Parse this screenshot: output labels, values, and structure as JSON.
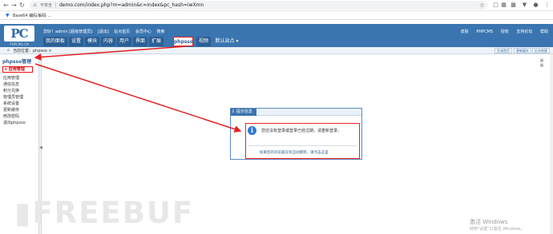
{
  "browser": {
    "insecure_label": "不安全",
    "url": "demo.com/index.php?m=admin&c=index&pc_hash=iwXmn",
    "bookmark_label": "Base64 编码/解码 ..."
  },
  "header": {
    "logo_text": "PC",
    "logo_sub": "PHPCMS.CN",
    "user_info": [
      "您好！admin [超级管理员]",
      "[退出]",
      "站点首页",
      "会员中心",
      "搜索"
    ],
    "right_links": [
      "皮肤",
      "PHPCMS",
      "授权",
      "支持论坛",
      "帮助"
    ],
    "tabs": [
      "我的面板",
      "设置",
      "模块",
      "内容",
      "用户",
      "界面",
      "扩展",
      "phpsso",
      "视频",
      "默认站点 ▾"
    ]
  },
  "breadcrumb": {
    "text": "当前位置：phpsso >",
    "buttons": [
      "生成首页",
      "更新缓存",
      "后台地图"
    ]
  },
  "sidebar": {
    "title": "phpsso管理",
    "items": [
      "+ 应用管理",
      "应用管理",
      "通信信息",
      "积分兑换",
      "管理员管理",
      "系统设置",
      "更新缓存",
      "修改密码",
      "退出phpsso"
    ]
  },
  "dialog": {
    "title": "提示信息",
    "message": "您还没有登录或登录已经过期，请重新登录。",
    "link_text": "如果您的浏览器没有自动跳转，请点击这里"
  },
  "watermark": {
    "brand": "FREEBUF",
    "activate_title": "激活 Windows",
    "activate_sub": "转到\"设置\"以激活 Windows。"
  },
  "colors": {
    "header_blue": "#3a75af",
    "tab_blue": "#2c5f94",
    "highlight_red": "#e22222",
    "info_blue": "#2e7bd6"
  }
}
